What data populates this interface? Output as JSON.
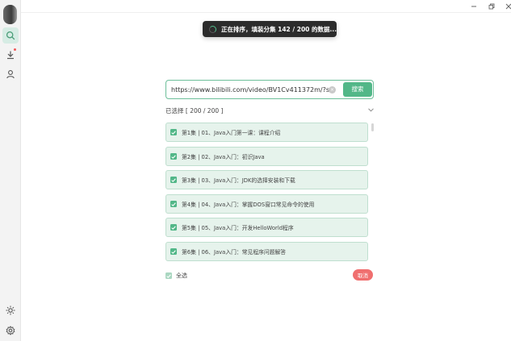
{
  "toast": {
    "text": "正在排序，填装分集 142 / 200 的数据..."
  },
  "search": {
    "url_value": "https://www.bilibili.com/video/BV1Cv411372m/?s",
    "button_label": "搜索",
    "clear_symbol": "×"
  },
  "selection": {
    "label": "已选择 [ 200 / 200 ]",
    "selected": 200,
    "total": 200
  },
  "episodes": [
    {
      "label": "第1集 | 01、Java入门第一课：课程介绍",
      "checked": true
    },
    {
      "label": "第2集 | 02、Java入门：初识Java",
      "checked": true
    },
    {
      "label": "第3集 | 03、Java入门：JDK的选择安装和下载",
      "checked": true
    },
    {
      "label": "第4集 | 04、Java入门：掌握DOS窗口常见命令的使用",
      "checked": true
    },
    {
      "label": "第5集 | 05、Java入门：开发HelloWorld程序",
      "checked": true
    },
    {
      "label": "第6集 | 06、Java入门：常见程序问题解答",
      "checked": true
    }
  ],
  "footer": {
    "select_all_label": "全选",
    "cancel_label": "取消"
  },
  "sidebar": {
    "items": [
      {
        "name": "search-icon"
      },
      {
        "name": "download-icon",
        "has_badge": true
      },
      {
        "name": "user-icon"
      },
      {
        "name": "theme-icon"
      },
      {
        "name": "settings-icon"
      }
    ]
  },
  "colors": {
    "accent": "#52b788",
    "danger": "#f06f6f",
    "item_bg": "#e6f3ec",
    "toast_bg": "#2c2c2c"
  }
}
